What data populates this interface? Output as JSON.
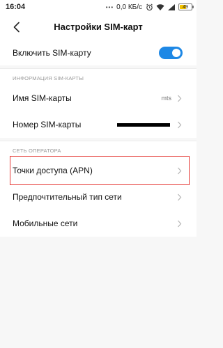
{
  "status_bar": {
    "time": "16:04",
    "dots": "•••",
    "speed": "0,0 КБ/с",
    "battery_level": "49"
  },
  "header": {
    "title": "Настройки SIM-карт",
    "back_icon": "chevron-left-icon"
  },
  "toggle_row": {
    "label": "Включить SIM-карту",
    "enabled": true
  },
  "sections": {
    "sim_info": {
      "title": "ИНФОРМАЦИЯ SIM-КАРТЫ",
      "items": [
        {
          "label": "Имя SIM-карты",
          "value": "mts"
        },
        {
          "label": "Номер SIM-карты",
          "value": ""
        }
      ]
    },
    "operator": {
      "title": "СЕТЬ ОПЕРАТОРА",
      "items": [
        {
          "label": "Точки доступа (APN)"
        },
        {
          "label": "Предпочтительный тип сети"
        },
        {
          "label": "Мобильные сети"
        }
      ]
    }
  },
  "colors": {
    "accent": "#1e88e5",
    "highlight": "#e53935",
    "background": "#f7f7f7"
  }
}
